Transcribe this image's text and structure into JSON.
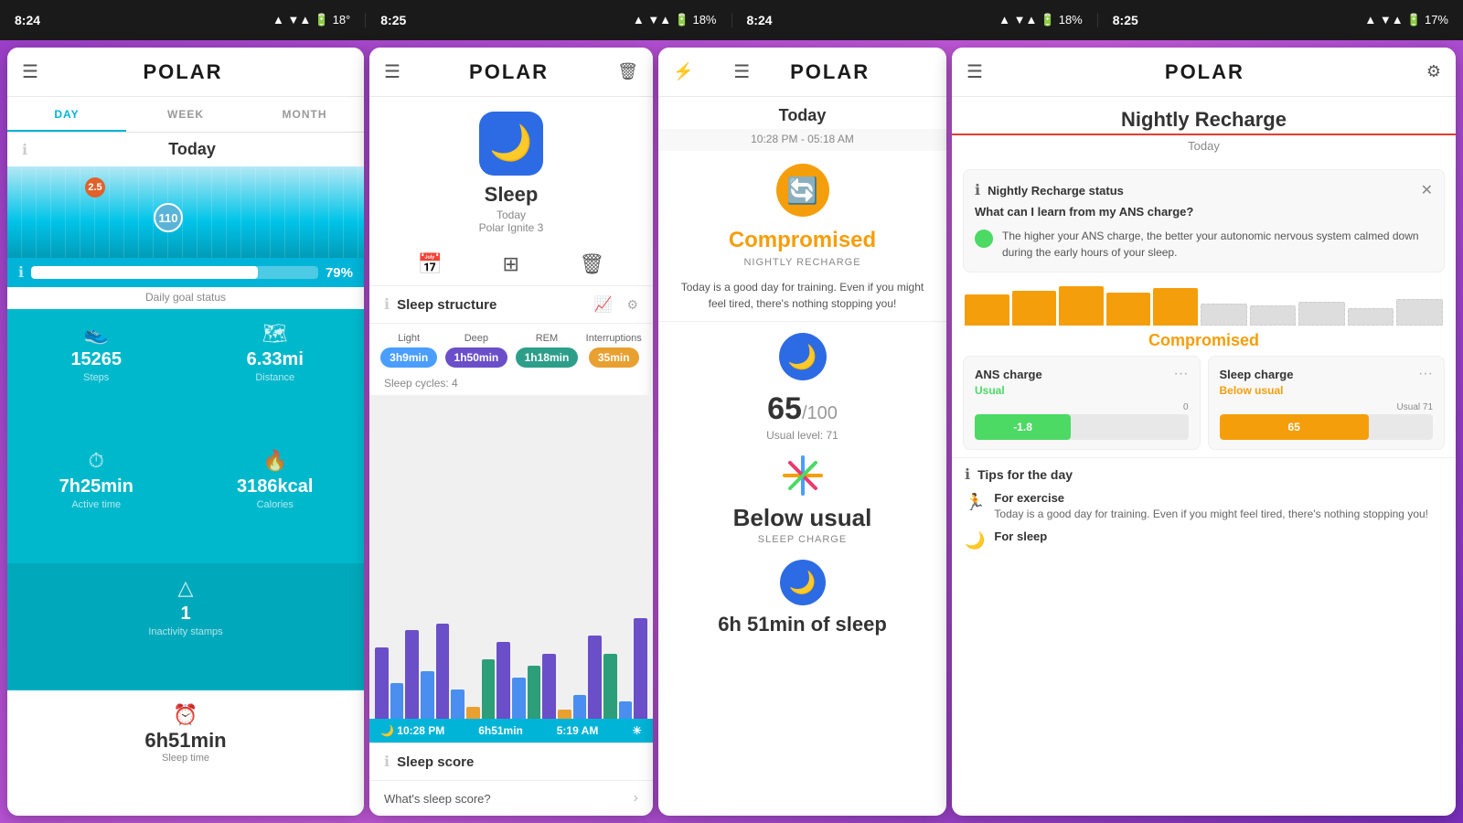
{
  "statusBars": [
    {
      "time": "8:24",
      "signal": "▲",
      "network": "▼▲ ⬛ 18°",
      "battery": ""
    },
    {
      "time": "8:25",
      "signal": "▲",
      "network": "▼▲ ⬛ 18%",
      "battery": ""
    },
    {
      "time": "8:24",
      "signal": "▲",
      "network": "▼▲ ⬛ 18%",
      "battery": ""
    },
    {
      "time": "8:25",
      "signal": "▲",
      "network": "▼▲ ⬛ 17%",
      "battery": ""
    }
  ],
  "panel1": {
    "title": "POLAR",
    "tabs": [
      "DAY",
      "WEEK",
      "MONTH"
    ],
    "activeTab": "DAY",
    "headerLabel": "Today",
    "scoreBadge1": "2.5",
    "scoreBadge2": "110",
    "progressPct": "79%",
    "dailyGoal": "Daily goal status",
    "stats": {
      "steps": "15265",
      "stepsLabel": "Steps",
      "distance": "6.33mi",
      "distanceLabel": "Distance",
      "activeTime": "7h25min",
      "activeTimeLabel": "Active time",
      "calories": "3186kcal",
      "caloriesLabel": "Calories",
      "inactivityStamps": "1",
      "inactivityLabel": "Inactivity stamps",
      "sleepTime": "6h51min",
      "sleepLabel": "Sleep time"
    }
  },
  "panel2": {
    "title": "POLAR",
    "sleepTitle": "Sleep",
    "sleepSubtitle": "Today",
    "sleepDevice": "Polar Ignite 3",
    "sectionTitle": "Sleep structure",
    "legend": {
      "light": "Light",
      "deep": "Deep",
      "rem": "REM",
      "interruptions": "Interruptions",
      "lightDuration": "3h9min",
      "deepDuration": "1h50min",
      "remDuration": "1h18min",
      "interruptionsDuration": "35min"
    },
    "cyclesLabel": "Sleep cycles: 4",
    "timeStart": "10:28 PM",
    "duration": "6h51min",
    "timeEnd": "5:19 AM",
    "scoreSectionTitle": "Sleep score",
    "scoreQuestion": "What's sleep score?"
  },
  "panel3": {
    "title": "POLAR",
    "headerLabel": "Today",
    "timeRange": "10:28 PM - 05:18 AM",
    "compromisedLabel": "Compromised",
    "nightlyRechargeLabel": "NIGHTLY RECHARGE",
    "description": "Today is a good day for training. Even if you might feel tired, there's nothing stopping you!",
    "sleepIconLabel": "🌙",
    "score": "65",
    "scoreDenom": "/100",
    "usualLevel": "Usual level: 71",
    "belowUsual": "Below usual",
    "sleepChargeLabel": "SLEEP CHARGE",
    "sleepDuration": "6h 51min of sleep"
  },
  "panel4": {
    "title": "POLAR",
    "mainTitle": "Nightly Recharge",
    "todayLabel": "Today",
    "statusTitle": "Nightly Recharge status",
    "question": "What can I learn from my ANS charge?",
    "infoText": "The higher your ANS charge, the better your autonomic nervous system calmed down during the early hours of your sleep.",
    "compromisedLabel": "Compromised",
    "ansCard": {
      "title": "ANS charge",
      "status": "Usual",
      "value": "-1.8",
      "zeroLabel": "0"
    },
    "sleepCard": {
      "title": "Sleep charge",
      "status": "Below usual",
      "usualLabel": "Usual 71",
      "value": "65"
    },
    "tips": {
      "sectionTitle": "Tips for the day",
      "items": [
        {
          "icon": "🏃",
          "heading": "For exercise",
          "text": "Today is a good day for training. Even if you might feel tired, there's nothing stopping you!"
        },
        {
          "icon": "🌙",
          "heading": "For sleep"
        }
      ]
    }
  }
}
